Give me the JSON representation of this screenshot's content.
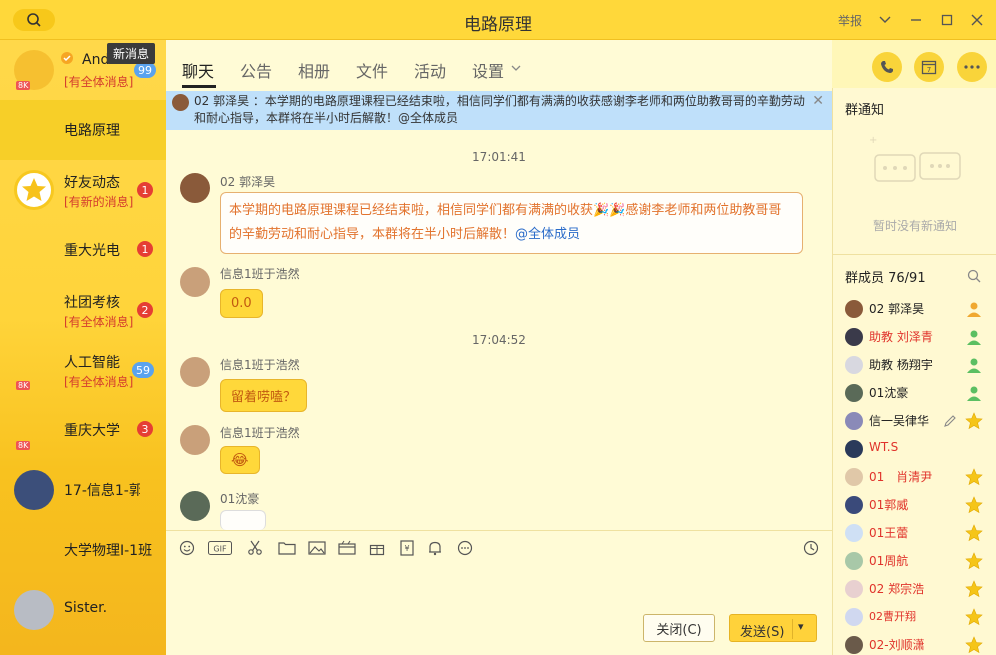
{
  "title": "电路原理",
  "report": "举报",
  "tooltip": "新消息",
  "sidebar": {
    "items": [
      {
        "name": "And",
        "sub": "[有全体消息]",
        "badge": "99",
        "badge_color": "blue"
      },
      {
        "name": "电路原理",
        "sub": "",
        "badge": ""
      },
      {
        "name": "好友动态",
        "sub": "[有新的消息]",
        "badge": "1"
      },
      {
        "name": "重大光电",
        "sub": "",
        "badge": "1"
      },
      {
        "name": "社团考核",
        "sub": "[有全体消息]",
        "badge": "2"
      },
      {
        "name": "人工智能",
        "sub": "[有全体消息]",
        "badge": "59",
        "badge_color": "blue"
      },
      {
        "name": "重庆大学",
        "sub": "",
        "badge": "3"
      },
      {
        "name": "17-信息1-郭",
        "sub": "",
        "badge": ""
      },
      {
        "name": "大学物理I-1班",
        "sub": "",
        "badge": ""
      },
      {
        "name": "Sister.",
        "sub": "",
        "badge": ""
      }
    ]
  },
  "tabs": [
    "聊天",
    "公告",
    "相册",
    "文件",
    "活动",
    "设置"
  ],
  "banner": {
    "text": "02 郭泽昊 ：本学期的电路原理课程已经结束啦，相信同学们都有满满的收获感谢李老师和两位助教哥哥的辛勤劳动和耐心指导，本群将在半小时后解散！@全体成员"
  },
  "chat": {
    "times": [
      "17:01:41",
      "17:04:52"
    ],
    "messages": [
      {
        "sender": "02 郭泽昊",
        "text_a": "本学期的电路原理课程已经结束啦，相信同学们都有满满的收获",
        "party": "🎉🎉",
        "text_b": "感谢李老师和两位助教哥哥",
        "text_c": "的辛勤劳动和耐心指导，本群将在半小时后解散！",
        "mention": "@全体成员"
      },
      {
        "sender": "信息1班于浩然",
        "text": "0.0"
      },
      {
        "sender": "信息1班于浩然",
        "text": "留着唠嗑？"
      },
      {
        "sender": "信息1班于浩然",
        "text": "😂"
      },
      {
        "sender": "01沈豪",
        "text": ""
      }
    ]
  },
  "buttons": {
    "close": "关闭(C)",
    "send": "发送(S)"
  },
  "right": {
    "notice_title": "群通知",
    "notice_empty": "暂时没有新通知",
    "members_title": "群成员 76/91",
    "members": [
      {
        "name": "02 郭泽昊",
        "red": false,
        "role": "owner"
      },
      {
        "name": "助教 刘泽青",
        "red": true,
        "role": "admin"
      },
      {
        "name": "助教 杨翔宇",
        "red": false,
        "role": "admin"
      },
      {
        "name": "01沈豪",
        "red": false,
        "role": "admin"
      },
      {
        "name": "信一吴律华",
        "red": false,
        "role": "star"
      },
      {
        "name": "WT.S",
        "red": true,
        "role": ""
      },
      {
        "name": "01　肖清尹",
        "red": true,
        "role": "star"
      },
      {
        "name": "01郭威",
        "red": true,
        "role": "star"
      },
      {
        "name": "01王蕾",
        "red": true,
        "role": "star"
      },
      {
        "name": "01周航",
        "red": true,
        "role": "star"
      },
      {
        "name": "02 郑宗浩",
        "red": true,
        "role": "star"
      },
      {
        "name": "02曹开翔",
        "red": true,
        "role": "star"
      },
      {
        "name": "02-刘顺潇",
        "red": true,
        "role": "star"
      }
    ]
  },
  "colors": {
    "accent": "#ffd83a",
    "badge_red": "#e53e34",
    "badge_blue": "#5aa3ee",
    "mention": "#2b6cc9",
    "banner": "#bfe0fa"
  }
}
